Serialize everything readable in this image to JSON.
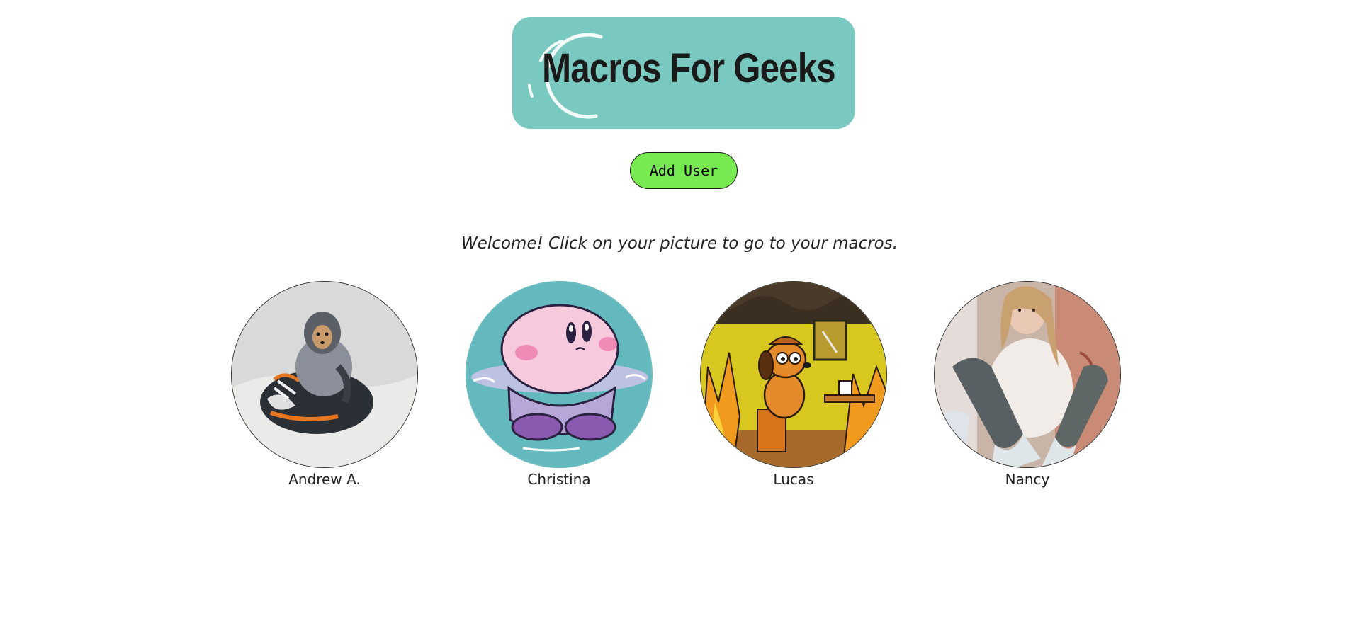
{
  "header": {
    "logo_text": "Macros For Geeks",
    "logo_bg_color": "#79c9c1"
  },
  "actions": {
    "add_user_label": "Add User",
    "add_user_color": "#77ea52"
  },
  "main": {
    "welcome_text": "Welcome! Click on your picture to go to your macros.",
    "users": [
      {
        "name": "Andrew A.",
        "avatar": "chihuahua-in-blanket-photo"
      },
      {
        "name": "Christina",
        "avatar": "kirby-in-water-illustration"
      },
      {
        "name": "Lucas",
        "avatar": "this-is-fine-dog-illustration"
      },
      {
        "name": "Nancy",
        "avatar": "person-sitting-photo"
      }
    ]
  }
}
